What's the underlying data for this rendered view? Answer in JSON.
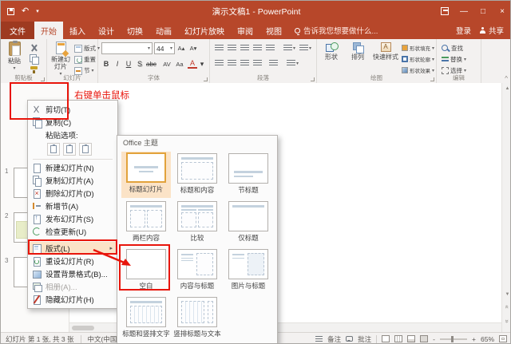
{
  "colors": {
    "accent": "#B7472A",
    "annotation": "#E8150B",
    "selection": "#E2A33C"
  },
  "icons": {
    "dropdown": "▾",
    "submenu": "▸",
    "scroll_up": "▲",
    "scroll_down": "▼",
    "prev_slide": "«",
    "next_slide": "»",
    "minimize": "—",
    "maximize": "□",
    "close": "×",
    "undo": "↶",
    "collapse": "^",
    "zoom_out": "-",
    "zoom_in": "+"
  },
  "window": {
    "title": "演示文稿1 - PowerPoint"
  },
  "tab_bar": {
    "file": "文件",
    "tabs": [
      "开始",
      "插入",
      "设计",
      "切换",
      "动画",
      "幻灯片放映",
      "审阅",
      "视图"
    ],
    "tell_me": "告诉我您想要做什么...",
    "sign_in": "登录",
    "share": "共享"
  },
  "ribbon": {
    "groups": {
      "clipboard": "剪贴板",
      "slides": "幻灯片",
      "font": "字体",
      "paragraph": "段落",
      "drawing": "绘图",
      "editing": "编辑"
    },
    "paste": "粘贴",
    "new_slide": "新建幻灯片",
    "layout": "版式",
    "reset": "重置",
    "section": "节",
    "font_size": "44",
    "grow": "A▴",
    "shrink": "A▾",
    "bold": "B",
    "italic": "I",
    "underline": "U",
    "shadow": "S",
    "strike": "abc",
    "char_spacing": "AV",
    "change_case": "Aa",
    "font_color": "A",
    "shapes": "形状",
    "arrange": "排列",
    "quick_styles": "快速样式",
    "shape_fill": "形状填充",
    "shape_outline": "形状轮廓",
    "shape_effects": "形状效果",
    "find": "查找",
    "replace": "替换",
    "select": "选择"
  },
  "slides_panel": {
    "numbers": [
      "1",
      "2",
      "3"
    ]
  },
  "annotations": {
    "right_click_text": "右键单击鼠标"
  },
  "context_menu": {
    "items": [
      "剪切(T)",
      "复制(C)",
      "粘贴选项:",
      "新建幻灯片(N)",
      "复制幻灯片(A)",
      "删除幻灯片(D)",
      "新增节(A)",
      "发布幻灯片(S)",
      "检查更新(U)",
      "版式(L)",
      "重设幻灯片(R)",
      "设置背景格式(B)...",
      "相册(A)...",
      "隐藏幻灯片(H)"
    ]
  },
  "gallery": {
    "header": "Office 主题",
    "layouts": [
      "标题幻灯片",
      "标题和内容",
      "节标题",
      "两栏内容",
      "比较",
      "仅标题",
      "空白",
      "内容与标题",
      "图片与标题",
      "标题和竖排文字",
      "竖排标题与文本"
    ]
  },
  "status_bar": {
    "slide_info": "幻灯片 第 1 张, 共 3 张",
    "language": "中文(中国)",
    "notes": "备注",
    "comments": "批注",
    "zoom": "65%"
  }
}
